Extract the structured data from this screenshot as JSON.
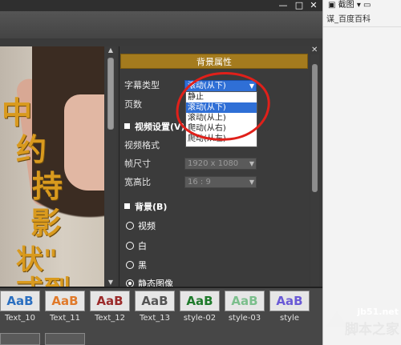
{
  "window": {
    "min_glyph": "—",
    "restore_glyph": "□",
    "close_glyph": "✕"
  },
  "browser": {
    "toolbar_text": "截图",
    "bookmark_text": "谋_百度百科"
  },
  "preview": {
    "big_chars": [
      "中",
      "约",
      "持",
      "影",
      "状\"",
      "式到"
    ]
  },
  "panel": {
    "title": "背景属性",
    "close_glyph": "✕",
    "subtitle_type_label": "字幕类型",
    "subtitle_type_value": "滚动(从下)",
    "pages_label": "页数",
    "video_section": "视频设置(V)",
    "video_format_label": "视频格式",
    "frame_size_label": "帧尺寸",
    "frame_size_value": "1920 x 1080",
    "aspect_label": "宽高比",
    "aspect_value": "16 : 9",
    "bg_section": "背景(B)",
    "radio_video": "视频",
    "radio_white": "白",
    "radio_black": "黑",
    "radio_image": "静态图像"
  },
  "dropdown": {
    "options": [
      "静止",
      "滚动(从下)",
      "滚动(从上)",
      "爬动(从右)",
      "爬动(从左)"
    ],
    "selected_index": 1
  },
  "thumbnails": [
    {
      "text": "AaB",
      "label": "Text_10",
      "color": "#2b6fc0"
    },
    {
      "text": "AaB",
      "label": "Text_11",
      "color": "#e07a2b"
    },
    {
      "text": "AaB",
      "label": "Text_12",
      "color": "#9b2b2b"
    },
    {
      "text": "AaB",
      "label": "Text_13",
      "color": "#555555"
    },
    {
      "text": "AaB",
      "label": "style-02",
      "color": "#1e7a2b"
    },
    {
      "text": "AaB",
      "label": "style-03",
      "color": "#7bbf8c"
    },
    {
      "text": "AaB",
      "label": "style",
      "color": "#6a5ad6"
    }
  ],
  "watermark": {
    "site": "jb51.net",
    "name": "脚本之家"
  },
  "colors": {
    "accent_header": "#a47b1e",
    "selection": "#2f6fd6",
    "annotation_red": "#e0201a"
  }
}
